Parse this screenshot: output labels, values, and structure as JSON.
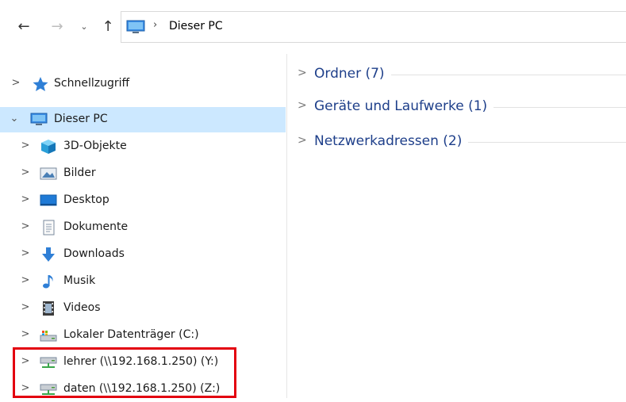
{
  "address_bar": {
    "back_glyph": "←",
    "forward_glyph": "→",
    "recent_glyph": "⌄",
    "up_glyph": "↑",
    "separator": "›",
    "path": "Dieser PC"
  },
  "nav_pane": {
    "chevron_collapsed": ">",
    "chevron_expanded": "⌄",
    "quick_access": "Schnellzugriff",
    "this_pc": "Dieser PC",
    "items": [
      {
        "label": "3D-Objekte",
        "icon": "3d-objects-icon"
      },
      {
        "label": "Bilder",
        "icon": "pictures-icon"
      },
      {
        "label": "Desktop",
        "icon": "desktop-icon"
      },
      {
        "label": "Dokumente",
        "icon": "documents-icon"
      },
      {
        "label": "Downloads",
        "icon": "downloads-icon"
      },
      {
        "label": "Musik",
        "icon": "music-icon"
      },
      {
        "label": "Videos",
        "icon": "videos-icon"
      },
      {
        "label": "Lokaler Datenträger (C:)",
        "icon": "local-disk-icon"
      },
      {
        "label": "lehrer (\\\\192.168.1.250) (Y:)",
        "icon": "network-drive-icon"
      },
      {
        "label": "daten (\\\\192.168.1.250) (Z:)",
        "icon": "network-drive-icon"
      }
    ],
    "highlight_color": "#e3000f",
    "selection_color": "#cce8ff"
  },
  "content": {
    "groups": [
      {
        "label": "Ordner (7)"
      },
      {
        "label": "Geräte und Laufwerke (1)"
      },
      {
        "label": "Netzwerkadressen (2)"
      }
    ],
    "group_chevron": ">",
    "accent_color": "#1e3f8a"
  }
}
